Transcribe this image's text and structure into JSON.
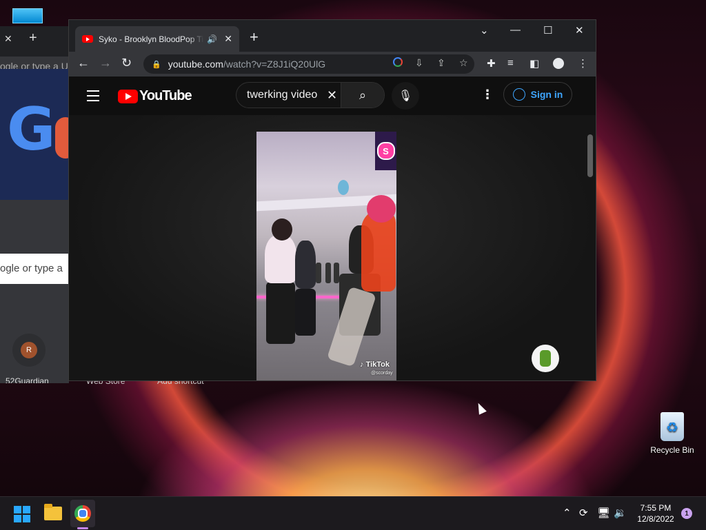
{
  "desktop": {
    "recycle_bin_label": "Recycle Bin"
  },
  "background_window": {
    "address_placeholder": "ogle or type a URL",
    "search_placeholder": "ogle or type a",
    "shortcut_initial": "R",
    "shortcut_label": "52Guardian",
    "bottom_labels": [
      "Web Store",
      "Add shortcut"
    ]
  },
  "browser": {
    "tab": {
      "title": "Syko - Brooklyn BloodPop TikTok",
      "close": "✕"
    },
    "new_tab": "+",
    "window_controls": {
      "dropdown": "⌄",
      "minimize": "—",
      "maximize": "☐",
      "close": "✕"
    },
    "address": {
      "host": "youtube.com",
      "path": "/watch?v=Z8J1iQ20UlG"
    }
  },
  "youtube": {
    "logo_text": "YouTube",
    "search_query": "twerking video",
    "sign_in_label": "Sign in",
    "video": {
      "watermark_brand": "TikTok",
      "watermark_handle": "@scorday"
    }
  },
  "taskbar": {
    "time": "7:55 PM",
    "date": "12/8/2022",
    "notification_count": "1"
  },
  "colors": {
    "youtube_red": "#ff0000",
    "link_blue": "#3ea6ff",
    "chrome_dark": "#202124",
    "chrome_toolbar": "#35363a"
  }
}
